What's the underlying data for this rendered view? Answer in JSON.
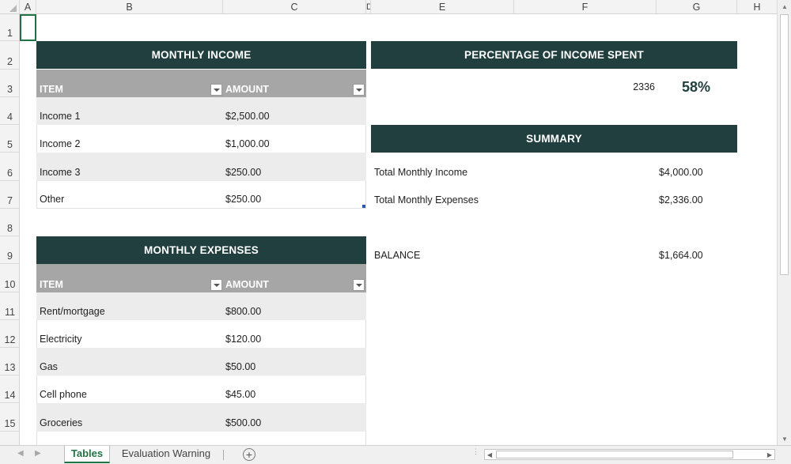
{
  "columns": [
    "A",
    "B",
    "C",
    "D",
    "E",
    "F",
    "G",
    "H"
  ],
  "rows": [
    "1",
    "2",
    "3",
    "4",
    "5",
    "6",
    "7",
    "8",
    "9",
    "10",
    "11",
    "12",
    "13",
    "14",
    "15"
  ],
  "income_table": {
    "title": "MONTHLY INCOME",
    "col_item": "ITEM",
    "col_amount": "AMOUNT",
    "rows": [
      {
        "item": "Income 1",
        "amount": "$2,500.00"
      },
      {
        "item": "Income 2",
        "amount": "$1,000.00"
      },
      {
        "item": "Income 3",
        "amount": "$250.00"
      },
      {
        "item": "Other",
        "amount": "$250.00"
      }
    ]
  },
  "expenses_table": {
    "title": "MONTHLY EXPENSES",
    "col_item": "ITEM",
    "col_amount": "AMOUNT",
    "rows": [
      {
        "item": "Rent/mortgage",
        "amount": "$800.00"
      },
      {
        "item": "Electricity",
        "amount": "$120.00"
      },
      {
        "item": "Gas",
        "amount": "$50.00"
      },
      {
        "item": "Cell phone",
        "amount": "$45.00"
      },
      {
        "item": "Groceries",
        "amount": "$500.00"
      }
    ]
  },
  "percentage": {
    "title": "PERCENTAGE OF INCOME SPENT",
    "value": "2336",
    "percent": "58%"
  },
  "summary": {
    "title": "SUMMARY",
    "total_income_label": "Total Monthly Income",
    "total_income_value": "$4,000.00",
    "total_expenses_label": "Total Monthly Expenses",
    "total_expenses_value": "$2,336.00",
    "balance_label": "BALANCE",
    "balance_value": "$1,664.00"
  },
  "sheet_tabs": [
    {
      "label": "Tables",
      "active": true
    },
    {
      "label": "Evaluation Warning",
      "active": false
    }
  ],
  "colors": {
    "header_dark": "#223f3f",
    "header_gray": "#a6a6a6",
    "row_alt": "#ececec",
    "accent": "#217346"
  }
}
